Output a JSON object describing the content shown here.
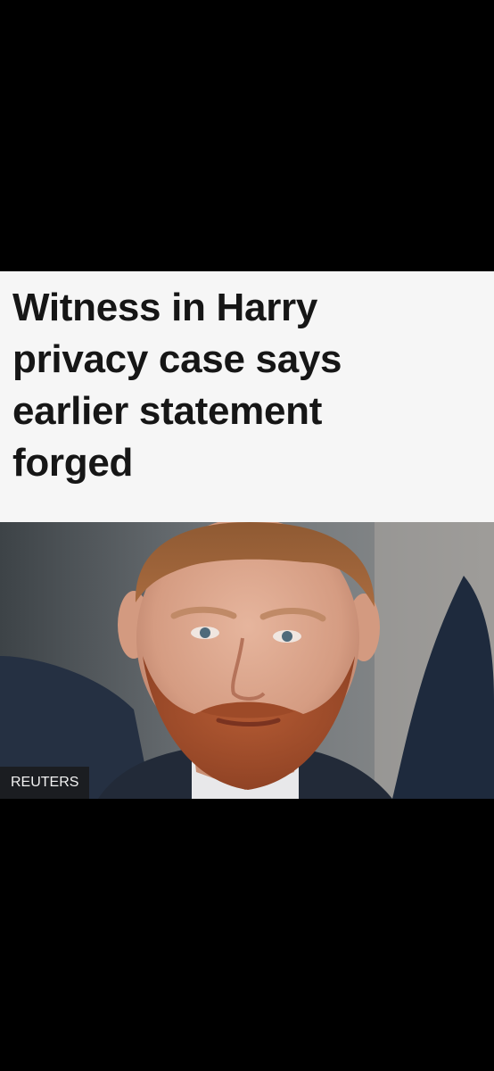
{
  "article": {
    "headline": "Witness in Harry privacy case says earlier statement forged",
    "image": {
      "description_icon": "portrait-photo",
      "credit": "REUTERS"
    }
  },
  "colors": {
    "background": "#000000",
    "panel": "#f6f6f6",
    "headline_text": "#161616"
  }
}
